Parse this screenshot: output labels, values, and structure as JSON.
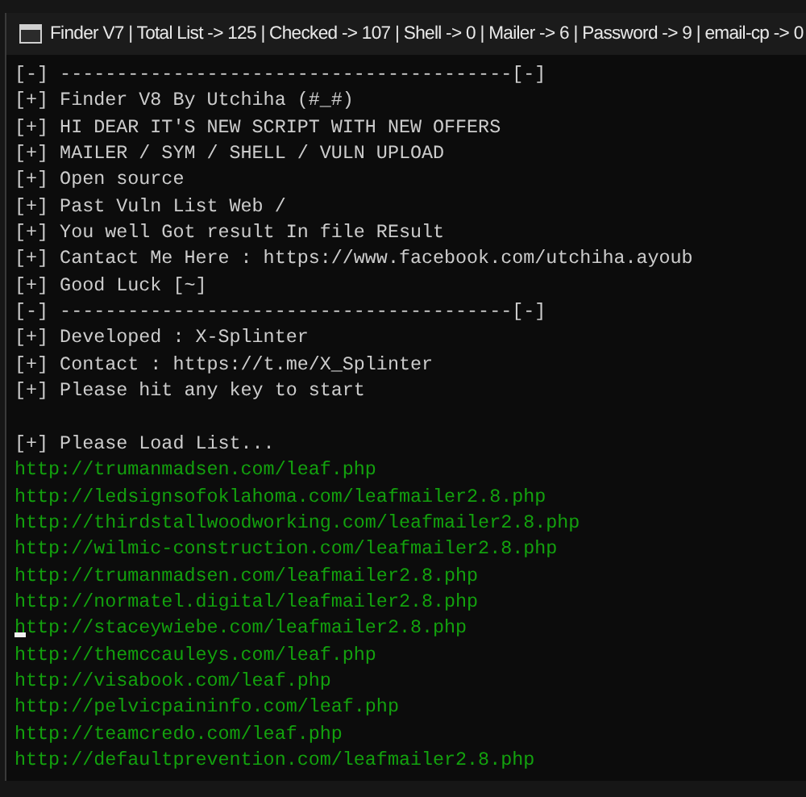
{
  "window": {
    "title": "Finder V7 | Total List -> 125 | Checked -> 107 | Shell -> 0 | Mailer -> 6 | Password -> 9 | email-cp -> 0"
  },
  "console": {
    "lines": [
      {
        "kind": "info",
        "text": "[-] ----------------------------------------[-]",
        "cursor": false
      },
      {
        "kind": "info",
        "text": "[+] Finder V8 By Utchiha (#_#)",
        "cursor": false
      },
      {
        "kind": "info",
        "text": "[+] HI DEAR IT'S NEW SCRIPT WITH NEW OFFERS",
        "cursor": false
      },
      {
        "kind": "info",
        "text": "[+] MAILER / SYM / SHELL / VULN UPLOAD",
        "cursor": false
      },
      {
        "kind": "info",
        "text": "[+] Open source",
        "cursor": false
      },
      {
        "kind": "info",
        "text": "[+] Past Vuln List Web /",
        "cursor": false
      },
      {
        "kind": "info",
        "text": "[+] You well Got result In file REsult",
        "cursor": false
      },
      {
        "kind": "info",
        "text": "[+] Cantact Me Here : https://www.facebook.com/utchiha.ayoub",
        "cursor": false
      },
      {
        "kind": "info",
        "text": "[+] Good Luck [~]",
        "cursor": false
      },
      {
        "kind": "info",
        "text": "[-] ----------------------------------------[-]",
        "cursor": false
      },
      {
        "kind": "info",
        "text": "[+] Developed : X-Splinter",
        "cursor": false
      },
      {
        "kind": "info",
        "text": "[+] Contact : https://t.me/X_Splinter",
        "cursor": false
      },
      {
        "kind": "info",
        "text": "[+] Please hit any key to start",
        "cursor": false
      },
      {
        "kind": "blank",
        "cursor": false
      },
      {
        "kind": "info",
        "text": "[+] Please Load List...",
        "cursor": false
      },
      {
        "kind": "url",
        "text": "http://trumanmadsen.com/leaf.php",
        "cursor": false
      },
      {
        "kind": "url",
        "text": "http://ledsignsofoklahoma.com/leafmailer2.8.php",
        "cursor": false
      },
      {
        "kind": "url",
        "text": "http://thirdstallwoodworking.com/leafmailer2.8.php",
        "cursor": false
      },
      {
        "kind": "url",
        "text": "http://wilmic-construction.com/leafmailer2.8.php",
        "cursor": false
      },
      {
        "kind": "url",
        "text": "http://trumanmadsen.com/leafmailer2.8.php",
        "cursor": false
      },
      {
        "kind": "url",
        "text": "http://normatel.digital/leafmailer2.8.php",
        "cursor": false
      },
      {
        "kind": "url",
        "text": "http://staceywiebe.com/leafmailer2.8.php",
        "cursor": true
      },
      {
        "kind": "url",
        "text": "http://themccauleys.com/leaf.php",
        "cursor": false
      },
      {
        "kind": "url",
        "text": "http://visabook.com/leaf.php",
        "cursor": false
      },
      {
        "kind": "url",
        "text": "http://pelvicpaininfo.com/leaf.php",
        "cursor": false
      },
      {
        "kind": "url",
        "text": "http://teamcredo.com/leaf.php",
        "cursor": false
      },
      {
        "kind": "url",
        "text": "http://defaultprevention.com/leafmailer2.8.php",
        "cursor": false
      }
    ]
  }
}
